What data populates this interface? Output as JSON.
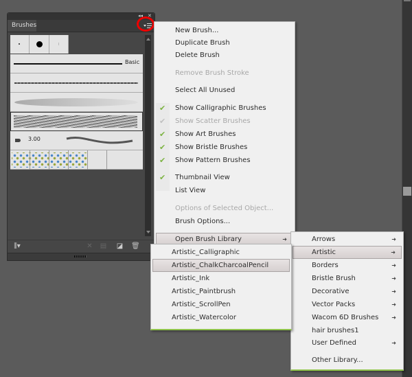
{
  "panel": {
    "tab_label": "Brushes",
    "brush_size_label": "3.00",
    "basic_label": "Basic",
    "menu_button_icon": "panel-menu-icon",
    "bottom_icons": [
      "brush-libraries-menu-icon",
      "remove-brush-stroke-icon",
      "options-icon",
      "new-brush-icon",
      "delete-brush-icon"
    ]
  },
  "main_menu": {
    "items": [
      {
        "label": "New Brush...",
        "enabled": true,
        "checked": false
      },
      {
        "label": "Duplicate Brush",
        "enabled": true,
        "checked": false
      },
      {
        "label": "Delete Brush",
        "enabled": true,
        "checked": false
      },
      {
        "label": "Remove Brush Stroke",
        "enabled": false,
        "checked": false
      },
      {
        "label": "Select All Unused",
        "enabled": true,
        "checked": false
      },
      {
        "label": "Show Calligraphic Brushes",
        "enabled": true,
        "checked": true
      },
      {
        "label": "Show Scatter Brushes",
        "enabled": false,
        "checked": true
      },
      {
        "label": "Show Art Brushes",
        "enabled": true,
        "checked": true
      },
      {
        "label": "Show Bristle Brushes",
        "enabled": true,
        "checked": true
      },
      {
        "label": "Show Pattern Brushes",
        "enabled": true,
        "checked": true
      },
      {
        "label": "Thumbnail View",
        "enabled": true,
        "checked": true
      },
      {
        "label": "List View",
        "enabled": true,
        "checked": false
      },
      {
        "label": "Options of Selected Object...",
        "enabled": false,
        "checked": false
      },
      {
        "label": "Brush Options...",
        "enabled": true,
        "checked": false
      },
      {
        "label": "Open Brush Library",
        "enabled": true,
        "checked": false,
        "submenu": true,
        "highlighted": true
      }
    ]
  },
  "library_menu": {
    "items": [
      {
        "label": "Arrows",
        "submenu": true
      },
      {
        "label": "Artistic",
        "submenu": true,
        "highlighted": true
      },
      {
        "label": "Borders",
        "submenu": true
      },
      {
        "label": "Bristle Brush",
        "submenu": true
      },
      {
        "label": "Decorative",
        "submenu": true
      },
      {
        "label": "Vector Packs",
        "submenu": true
      },
      {
        "label": "Wacom 6D Brushes",
        "submenu": true
      },
      {
        "label": "hair brushes1",
        "submenu": false
      },
      {
        "label": "User Defined",
        "submenu": true
      },
      {
        "label": "Other Library...",
        "submenu": false
      }
    ]
  },
  "artistic_menu": {
    "items": [
      {
        "label": "Artistic_Calligraphic"
      },
      {
        "label": "Artistic_ChalkCharcoalPencil",
        "highlighted": true
      },
      {
        "label": "Artistic_Ink"
      },
      {
        "label": "Artistic_Paintbrush"
      },
      {
        "label": "Artistic_ScrollPen"
      },
      {
        "label": "Artistic_Watercolor"
      }
    ]
  },
  "colors": {
    "check": "#7cb342",
    "highlight_circle": "#e00000",
    "menu_bg": "#f0f0f0",
    "accent_border": "#8fc34a"
  }
}
